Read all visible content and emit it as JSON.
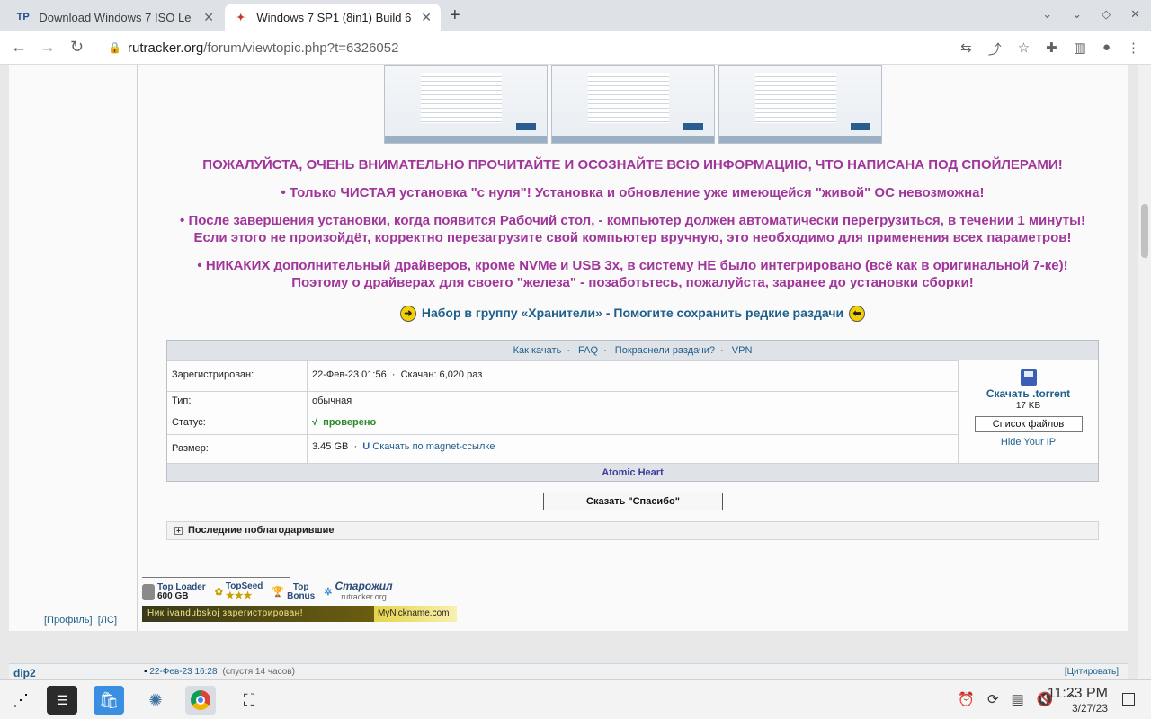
{
  "tabs": [
    {
      "favicon": "TP",
      "title": "Download Windows 7 ISO Le",
      "active": false
    },
    {
      "favicon": "✦",
      "title": "Windows 7 SP1 (8in1) Build 6",
      "active": true
    }
  ],
  "url": {
    "host": "rutracker.org",
    "path": "/forum/viewtopic.php?t=6326052"
  },
  "notices": [
    "ПОЖАЛУЙСТА, ОЧЕНЬ ВНИМАТЕЛЬНО ПРОЧИТАЙТЕ И ОСОЗНАЙТЕ ВСЮ ИНФОРМАЦИЮ, ЧТО НАПИСАНА ПОД СПОЙЛЕРАМИ!",
    "• Только ЧИСТАЯ установка \"с нуля\"! Установка и обновление уже имеющейся \"живой\" ОС невозможна!",
    "• После завершения установки, когда появится Рабочий стол, - компьютер должен автоматически перегрузиться, в течении 1 минуты!",
    "Если этого не произойдёт, корректно перезагрузите свой компьютер вручную, это необходимо для применения всех параметров!",
    "• НИКАКИХ дополнительный драйверов, кроме NVMe и USB 3x, в систему НЕ было интегрировано (всё как в оригинальной 7-ке)!",
    "Поэтому о драйверах для своего \"железа\" - позаботьтесь, пожалуйста, заранее до установки сборки!"
  ],
  "guardians_link": "Набор в группу «Хранители» - Помогите сохранить редкие раздачи",
  "torrent": {
    "header_links": [
      "Как качать",
      "FAQ",
      "Покраснели раздачи?",
      "VPN"
    ],
    "registered_label": "Зарегистрирован:",
    "registered_value": "22-Фев-23 01:56",
    "downloads": "Скачан: 6,020 раз",
    "type_label": "Тип:",
    "type_value": "обычная",
    "status_label": "Статус:",
    "status_check": "√",
    "status_value": "проверено",
    "size_label": "Размер:",
    "size_value": "3.45 GB",
    "magnet": "Скачать по magnet-ссылке",
    "download_label": "Скачать .torrent",
    "file_size": "17 KB",
    "file_list": "Список файлов",
    "hide_ip": "Hide Your IP",
    "footer": "Atomic Heart"
  },
  "thanks_button": "Сказать \"Спасибо\"",
  "last_thanked": "Последние поблагодарившие",
  "awards": {
    "top_loader": "Top Loader",
    "top_loader_size": "600 GB",
    "top_seed": "TopSeed",
    "top_bonus_1": "Top",
    "top_bonus_2": "Bonus",
    "oldtimer": "Старожил",
    "oldtimer_site": "rutracker.org",
    "nick_bar": "Ник ivandubskoj зарегистрирован!",
    "nick_site": "MyNickname.com"
  },
  "profile_links": [
    "[Профиль]",
    "[ЛС]"
  ],
  "next_post": {
    "user": "dip2",
    "date": "22-Фев-23 16:28",
    "after": "(спустя 14 часов)",
    "quote": "[Цитировать]"
  },
  "clock": {
    "time": "11:23 PM",
    "date": "3/27/23"
  }
}
